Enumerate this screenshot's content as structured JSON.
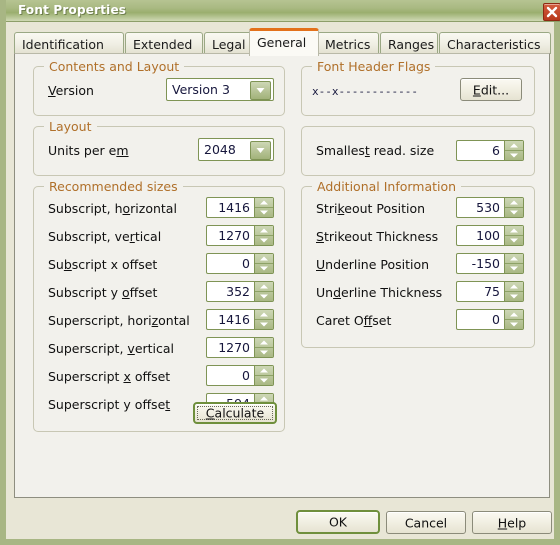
{
  "window": {
    "title": "Font Properties",
    "close_icon": "close-icon"
  },
  "tabs": [
    {
      "label": "Identification",
      "active": false
    },
    {
      "label": "Extended",
      "active": false
    },
    {
      "label": "Legal",
      "active": false
    },
    {
      "label": "General",
      "active": true
    },
    {
      "label": "Metrics",
      "active": false
    },
    {
      "label": "Ranges",
      "active": false
    },
    {
      "label": "Characteristics",
      "active": false
    }
  ],
  "groups": {
    "contents_and_layout": {
      "title": "Contents and Layout",
      "version_label_pre": "V",
      "version_label_mnemonic": "V",
      "version_label_rest": "ersion",
      "version_value": "Version 3"
    },
    "layout": {
      "title": "Layout",
      "units_label_a": "Units per e",
      "units_label_mnemonic": "m",
      "units_value": "2048"
    },
    "font_header_flags": {
      "title": "Font Header Flags",
      "flags_value": "x--x------------",
      "edit_label_pre": "",
      "edit_label_mnemonic": "E",
      "edit_label_rest": "dit..."
    },
    "smallest": {
      "label_a": "Smalles",
      "label_mnemonic": "t",
      "label_b": " read. size",
      "value": "6"
    },
    "recommended_sizes": {
      "title": "Recommended sizes",
      "rows": [
        {
          "a": "Subscript, h",
          "m": "o",
          "b": "rizontal",
          "value": "1416"
        },
        {
          "a": "Subscript, ve",
          "m": "r",
          "b": "tical",
          "value": "1270"
        },
        {
          "a": "Su",
          "m": "b",
          "b": "script x offset",
          "value": "0"
        },
        {
          "a": "Subscript y ",
          "m": "o",
          "b": "ffset",
          "value": "352"
        },
        {
          "a": "Superscript, hori",
          "m": "z",
          "b": "ontal",
          "value": "1416"
        },
        {
          "a": "Superscript, ",
          "m": "v",
          "b": "ertical",
          "value": "1270"
        },
        {
          "a": "Superscript ",
          "m": "x",
          "b": " offset",
          "value": "0"
        },
        {
          "a": "Superscript y offse",
          "m": "t",
          "b": "",
          "value": "594"
        }
      ],
      "calculate_a": "",
      "calculate_m": "C",
      "calculate_b": "alculate"
    },
    "additional_information": {
      "title": "Additional Information",
      "rows": [
        {
          "a": "Stri",
          "m": "k",
          "b": "eout Position",
          "value": "530"
        },
        {
          "a": "",
          "m": "S",
          "b": "trikeout Thickness",
          "value": "100"
        },
        {
          "a": "",
          "m": "U",
          "b": "nderline Position",
          "value": "-150"
        },
        {
          "a": "Un",
          "m": "d",
          "b": "erline Thickness",
          "value": "75"
        },
        {
          "a": "Caret O",
          "m": "f",
          "b": "fset",
          "value": "0"
        }
      ]
    }
  },
  "footer": {
    "ok": "OK",
    "cancel": "Cancel",
    "help_pre": "",
    "help_mnemonic": "H",
    "help_rest": "elp"
  },
  "colors": {
    "titlebar_green": "#a9b982",
    "window_border": "#a8b684",
    "accent_orange": "#e3711b",
    "group_title": "#b0702a",
    "content_bg": "#f2f1ec",
    "spinner_border": "#7f9455",
    "close_red": "#b8391c"
  }
}
